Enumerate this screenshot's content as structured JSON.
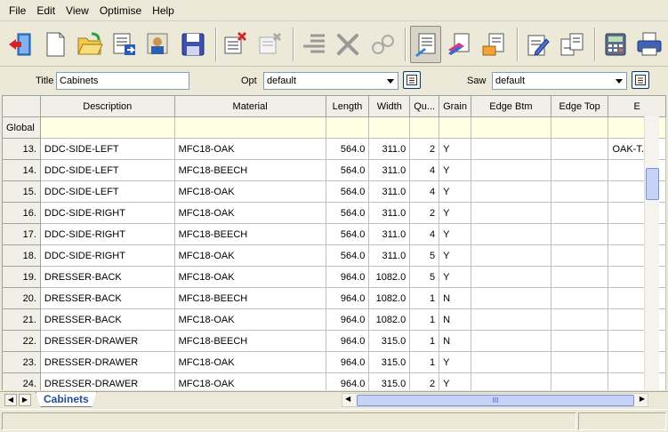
{
  "menu": [
    "File",
    "Edit",
    "View",
    "Optimise",
    "Help"
  ],
  "properties": {
    "title_label": "Title",
    "title_value": "Cabinets",
    "opt_label": "Opt",
    "opt_value": "default",
    "saw_label": "Saw",
    "saw_value": "default"
  },
  "grid": {
    "columns": [
      "Description",
      "Material",
      "Length",
      "Width",
      "Qu...",
      "Grain",
      "Edge Btm",
      "Edge Top",
      "E"
    ],
    "global_label": "Global",
    "rows": [
      {
        "n": "13.",
        "desc": "DDC-SIDE-LEFT",
        "mat": "MFC18-OAK",
        "len": "564.0",
        "wid": "311.0",
        "qty": "2",
        "grain": "Y",
        "ebtm": "",
        "etop": "",
        "e": "OAK-T..."
      },
      {
        "n": "14.",
        "desc": "DDC-SIDE-LEFT",
        "mat": "MFC18-BEECH",
        "len": "564.0",
        "wid": "311.0",
        "qty": "4",
        "grain": "Y",
        "ebtm": "",
        "etop": "",
        "e": ""
      },
      {
        "n": "15.",
        "desc": "DDC-SIDE-LEFT",
        "mat": "MFC18-OAK",
        "len": "564.0",
        "wid": "311.0",
        "qty": "4",
        "grain": "Y",
        "ebtm": "",
        "etop": "",
        "e": ""
      },
      {
        "n": "16.",
        "desc": "DDC-SIDE-RIGHT",
        "mat": "MFC18-OAK",
        "len": "564.0",
        "wid": "311.0",
        "qty": "2",
        "grain": "Y",
        "ebtm": "",
        "etop": "",
        "e": ""
      },
      {
        "n": "17.",
        "desc": "DDC-SIDE-RIGHT",
        "mat": "MFC18-BEECH",
        "len": "564.0",
        "wid": "311.0",
        "qty": "4",
        "grain": "Y",
        "ebtm": "",
        "etop": "",
        "e": ""
      },
      {
        "n": "18.",
        "desc": "DDC-SIDE-RIGHT",
        "mat": "MFC18-OAK",
        "len": "564.0",
        "wid": "311.0",
        "qty": "5",
        "grain": "Y",
        "ebtm": "",
        "etop": "",
        "e": ""
      },
      {
        "n": "19.",
        "desc": "DRESSER-BACK",
        "mat": "MFC18-OAK",
        "len": "964.0",
        "wid": "1082.0",
        "qty": "5",
        "grain": "Y",
        "ebtm": "",
        "etop": "",
        "e": ""
      },
      {
        "n": "20.",
        "desc": "DRESSER-BACK",
        "mat": "MFC18-BEECH",
        "len": "964.0",
        "wid": "1082.0",
        "qty": "1",
        "grain": "N",
        "ebtm": "",
        "etop": "",
        "e": ""
      },
      {
        "n": "21.",
        "desc": "DRESSER-BACK",
        "mat": "MFC18-OAK",
        "len": "964.0",
        "wid": "1082.0",
        "qty": "1",
        "grain": "N",
        "ebtm": "",
        "etop": "",
        "e": ""
      },
      {
        "n": "22.",
        "desc": "DRESSER-DRAWER",
        "mat": "MFC18-BEECH",
        "len": "964.0",
        "wid": "315.0",
        "qty": "1",
        "grain": "N",
        "ebtm": "",
        "etop": "",
        "e": ""
      },
      {
        "n": "23.",
        "desc": "DRESSER-DRAWER",
        "mat": "MFC18-OAK",
        "len": "964.0",
        "wid": "315.0",
        "qty": "1",
        "grain": "Y",
        "ebtm": "",
        "etop": "",
        "e": ""
      },
      {
        "n": "24.",
        "desc": "DRESSER-DRAWER",
        "mat": "MFC18-OAK",
        "len": "964.0",
        "wid": "315.0",
        "qty": "2",
        "grain": "Y",
        "ebtm": "",
        "etop": "",
        "e": ""
      }
    ]
  },
  "sheet_tab": "Cabinets",
  "hscroll_grip": "III",
  "icons": [
    "exit-icon",
    "new-icon",
    "open-icon",
    "list-icon",
    "users-icon",
    "save-icon",
    "delete-rows-icon",
    "clear-icon",
    "align-icon",
    "cut-icon",
    "link-icon",
    "parts-list-icon",
    "edge-icon",
    "labels-icon",
    "edit-icon",
    "grid-icon",
    "calculator-icon",
    "print-icon"
  ]
}
